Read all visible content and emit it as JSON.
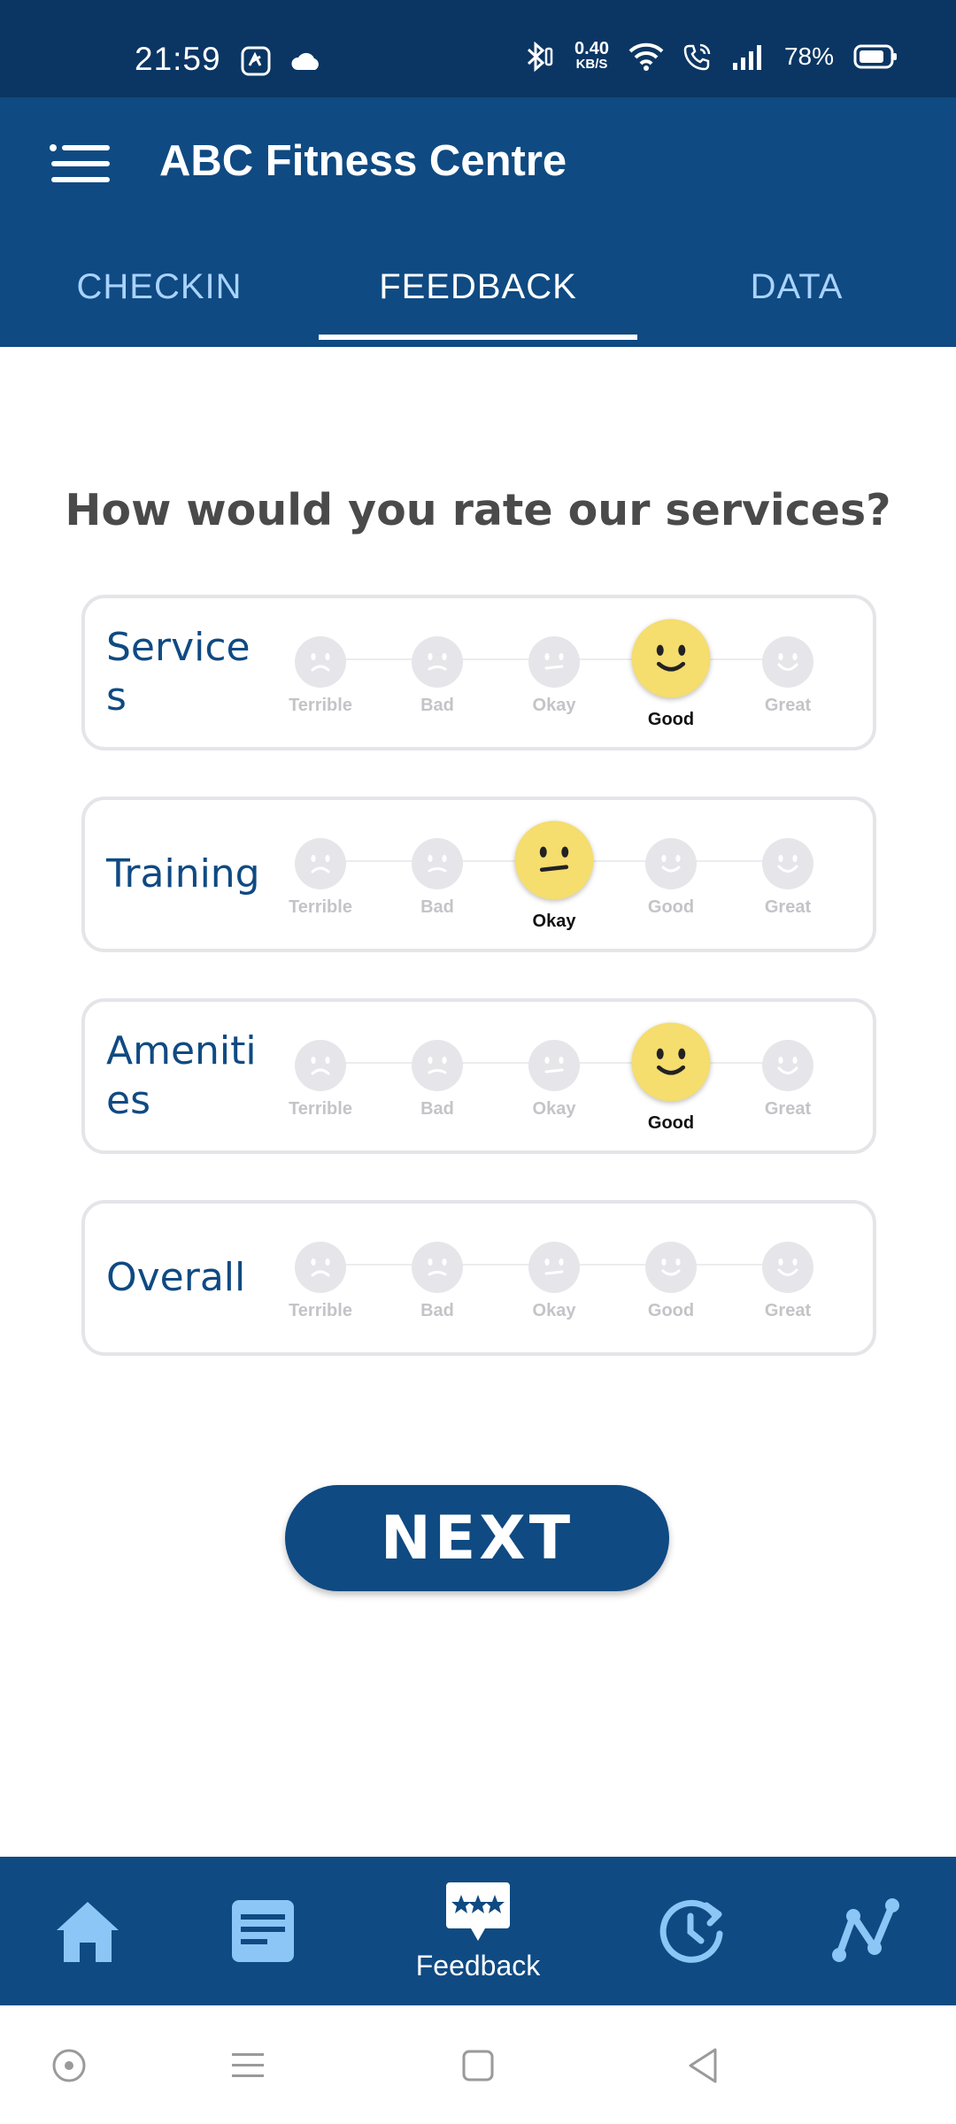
{
  "status_bar": {
    "time": "21:59",
    "network_speed_value": "0.40",
    "network_speed_unit": "KB/S",
    "battery": "78%",
    "icons": [
      "jiosaavn-icon",
      "cloud-icon",
      "bluetooth-icon",
      "wifi-icon",
      "wifi-calling-icon",
      "signal-icon",
      "battery-icon"
    ]
  },
  "app_bar": {
    "title": "ABC Fitness Centre",
    "menu_icon": "hamburger-menu-icon"
  },
  "tabs": [
    {
      "label": "CHECKIN",
      "active": false
    },
    {
      "label": "FEEDBACK",
      "active": true
    },
    {
      "label": "DATA",
      "active": false
    }
  ],
  "question": "How would you rate our services?",
  "rating_scale": [
    "Terrible",
    "Bad",
    "Okay",
    "Good",
    "Great"
  ],
  "categories": [
    {
      "label": "Services",
      "selected": "Good"
    },
    {
      "label": "Training",
      "selected": "Okay"
    },
    {
      "label": "Amenities",
      "selected": "Good"
    },
    {
      "label": "Overall",
      "selected": null
    }
  ],
  "next_button": "NEXT",
  "bottom_nav": {
    "items": [
      "home-icon",
      "notes-icon",
      "feedback-icon",
      "history-icon",
      "stats-icon"
    ],
    "active_label": "Feedback"
  },
  "colors": {
    "primary": "#0f4a82",
    "status_bar": "#0b3663",
    "tab_inactive": "#a9d3ff",
    "smiley_selected": "#f5dd6e",
    "smiley_inactive": "#e6e6ea",
    "nav_icon": "#8cc6f7"
  }
}
